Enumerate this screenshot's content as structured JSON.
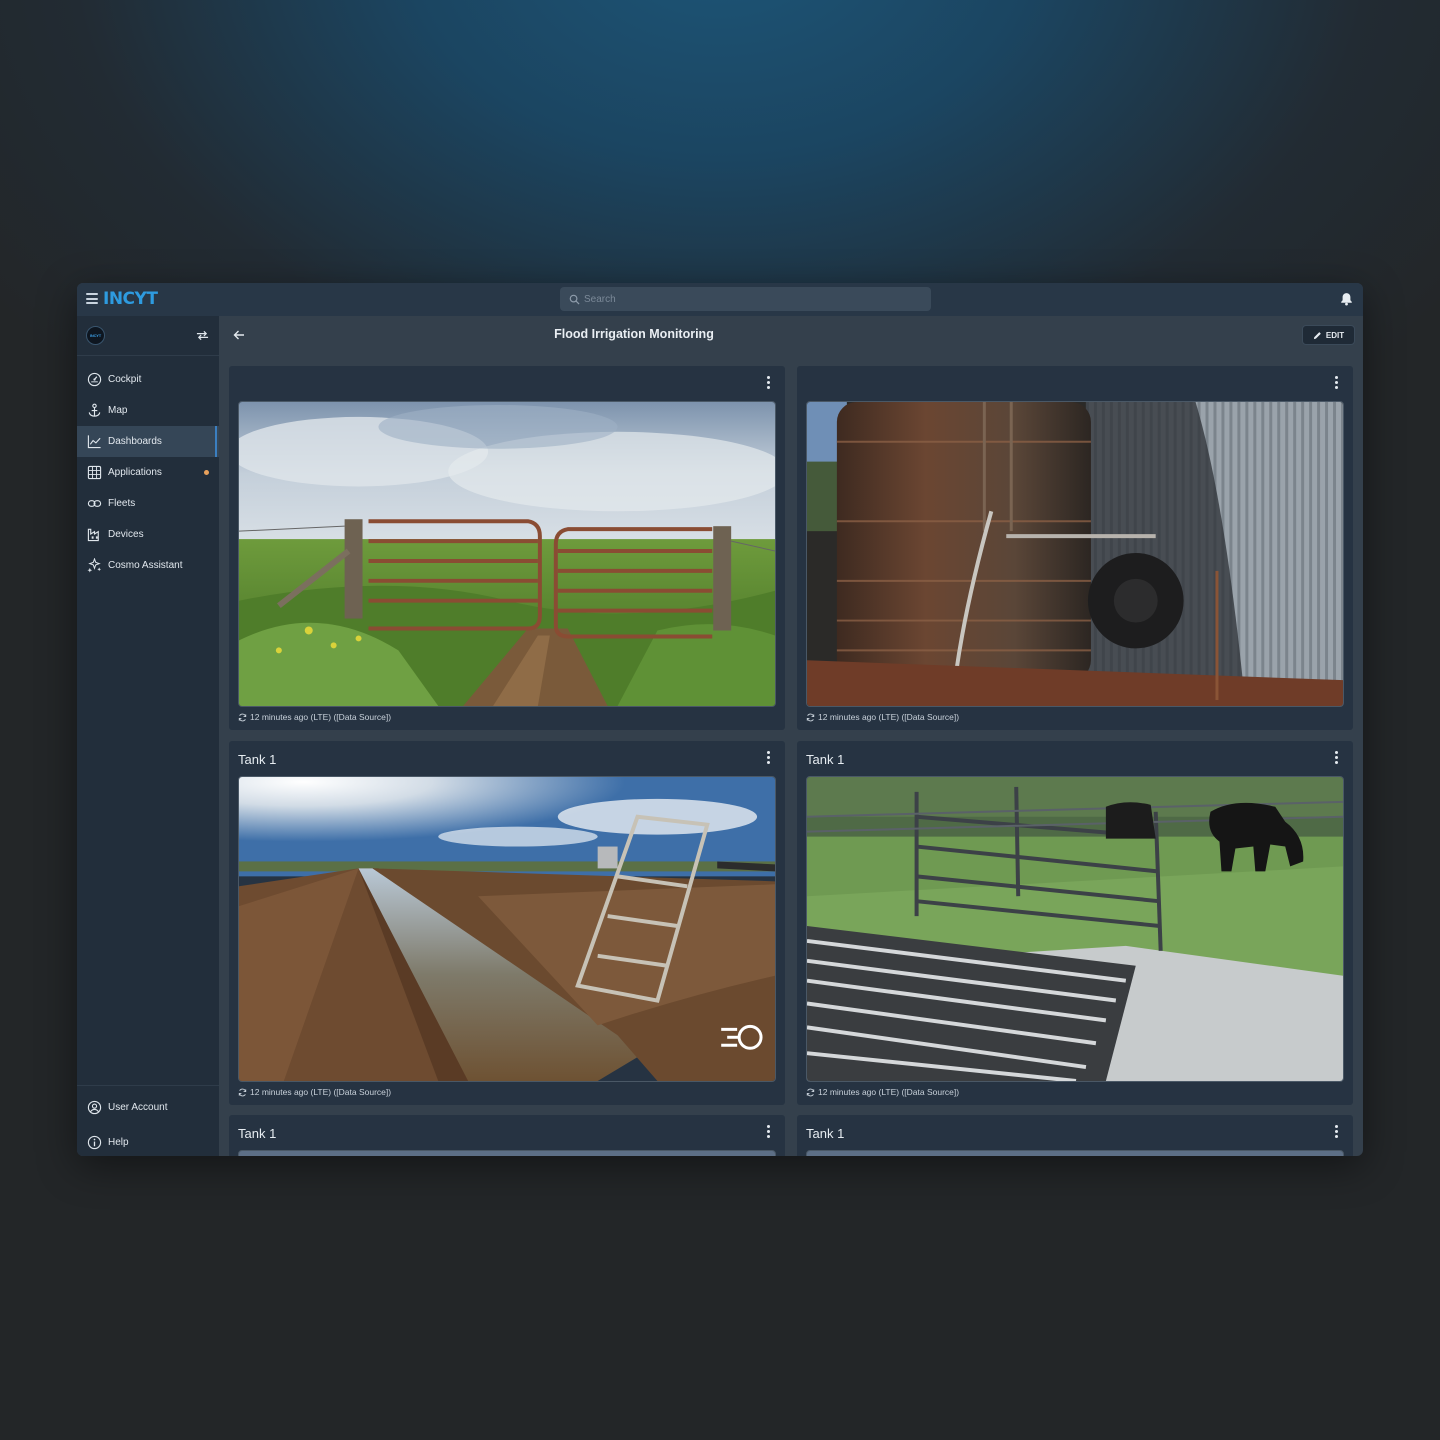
{
  "app": {
    "logo": "INCYT",
    "org_avatar_text": "INCYT"
  },
  "search": {
    "placeholder": "Search"
  },
  "sidebar": {
    "items": [
      {
        "label": "Cockpit",
        "icon": "gauge-icon"
      },
      {
        "label": "Map",
        "icon": "anchor-icon"
      },
      {
        "label": "Dashboards",
        "icon": "chart-line-icon",
        "active": true
      },
      {
        "label": "Applications",
        "icon": "grid-icon",
        "badge_color": "#e8a15c"
      },
      {
        "label": "Fleets",
        "icon": "link-icon"
      },
      {
        "label": "Devices",
        "icon": "factory-icon"
      },
      {
        "label": "Cosmo Assistant",
        "icon": "sparkle-icon"
      }
    ],
    "bottom": [
      {
        "label": "User Account",
        "icon": "user-circle-icon"
      },
      {
        "label": "Help",
        "icon": "info-icon"
      }
    ]
  },
  "page": {
    "title": "Flood Irrigation Monitoring",
    "edit_label": "EDIT"
  },
  "cards": [
    {
      "title": "",
      "image": "farm-gate-photo",
      "caption": "12 minutes ago (LTE)  ([Data Source])"
    },
    {
      "title": "",
      "image": "rusty-water-tank-photo",
      "caption": "12 minutes ago (LTE)  ([Data Source])"
    },
    {
      "title": "Tank 1",
      "image": "irrigation-canal-photo",
      "caption": "12 minutes ago (LTE)  ([Data Source])"
    },
    {
      "title": "Tank 1",
      "image": "cattle-grid-photo",
      "caption": "12 minutes ago (LTE)  ([Data Source])"
    },
    {
      "title": "Tank 1",
      "image": "",
      "caption": ""
    },
    {
      "title": "Tank 1",
      "image": "",
      "caption": ""
    }
  ],
  "colors": {
    "accent": "#2e9be0",
    "background": "#34404c",
    "sidebar": "#222e3b",
    "card": "#263342"
  }
}
